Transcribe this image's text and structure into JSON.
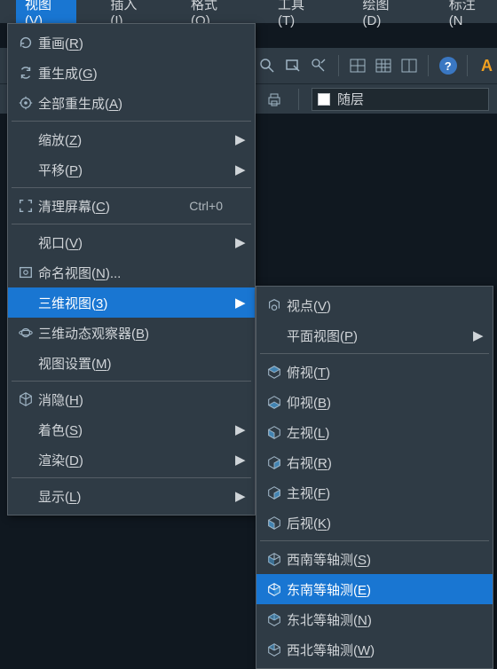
{
  "menubar": {
    "items": [
      {
        "text": "视图(V)",
        "open": true
      },
      {
        "text": "插入(I)",
        "open": false
      },
      {
        "text": "格式(O)",
        "open": false
      },
      {
        "text": "工具(T)",
        "open": false
      },
      {
        "text": "绘图(D)",
        "open": false
      },
      {
        "text": "标注(N",
        "open": false
      }
    ]
  },
  "layer": {
    "current": "随层"
  },
  "primary_menu": [
    {
      "kind": "item",
      "icon": "refresh-icon",
      "label": "重画",
      "accel": "R",
      "submenu": false
    },
    {
      "kind": "item",
      "icon": "regen-icon",
      "label": "重生成",
      "accel": "G",
      "submenu": false
    },
    {
      "kind": "item",
      "icon": "regen-all-icon",
      "label": "全部重生成",
      "accel": "A",
      "submenu": false
    },
    {
      "kind": "sep"
    },
    {
      "kind": "item",
      "icon": "",
      "label": "缩放",
      "accel": "Z",
      "submenu": true
    },
    {
      "kind": "item",
      "icon": "",
      "label": "平移",
      "accel": "P",
      "submenu": true
    },
    {
      "kind": "sep"
    },
    {
      "kind": "item",
      "icon": "fullscreen-icon",
      "label": "清理屏幕",
      "accel": "C",
      "shortcut": "Ctrl+0",
      "submenu": false
    },
    {
      "kind": "sep"
    },
    {
      "kind": "item",
      "icon": "",
      "label": "视口",
      "accel": "V",
      "submenu": true
    },
    {
      "kind": "item",
      "icon": "named-view-icon",
      "label": "命名视图",
      "accel": "N",
      "suffix": "...",
      "submenu": false
    },
    {
      "kind": "item",
      "icon": "",
      "label": "三维视图",
      "accel": "3",
      "submenu": true,
      "highlight": true
    },
    {
      "kind": "item",
      "icon": "orbit-icon",
      "label": "三维动态观察器",
      "accel": "B",
      "submenu": false
    },
    {
      "kind": "item",
      "icon": "",
      "label": "视图设置",
      "accel": "M",
      "submenu": false
    },
    {
      "kind": "sep"
    },
    {
      "kind": "item",
      "icon": "cube-icon",
      "label": "消隐",
      "accel": "H",
      "submenu": false
    },
    {
      "kind": "item",
      "icon": "",
      "label": "着色",
      "accel": "S",
      "submenu": true
    },
    {
      "kind": "item",
      "icon": "",
      "label": "渲染",
      "accel": "D",
      "submenu": true
    },
    {
      "kind": "sep"
    },
    {
      "kind": "item",
      "icon": "",
      "label": "显示",
      "accel": "L",
      "submenu": true
    }
  ],
  "secondary_menu": [
    {
      "kind": "item",
      "icon": "viewpoint-icon",
      "label": "视点",
      "accel": "V",
      "submenu": false
    },
    {
      "kind": "item",
      "icon": "",
      "label": "平面视图",
      "accel": "P",
      "submenu": true
    },
    {
      "kind": "sep"
    },
    {
      "kind": "item",
      "icon": "face-top-icon",
      "label": "俯视",
      "accel": "T",
      "submenu": false
    },
    {
      "kind": "item",
      "icon": "face-bottom-icon",
      "label": "仰视",
      "accel": "B",
      "submenu": false
    },
    {
      "kind": "item",
      "icon": "face-left-icon",
      "label": "左视",
      "accel": "L",
      "submenu": false
    },
    {
      "kind": "item",
      "icon": "face-right-icon",
      "label": "右视",
      "accel": "R",
      "submenu": false
    },
    {
      "kind": "item",
      "icon": "face-front-icon",
      "label": "主视",
      "accel": "F",
      "submenu": false
    },
    {
      "kind": "item",
      "icon": "face-back-icon",
      "label": "后视",
      "accel": "K",
      "submenu": false
    },
    {
      "kind": "sep"
    },
    {
      "kind": "item",
      "icon": "iso-sw-icon",
      "label": "西南等轴测",
      "accel": "S",
      "submenu": false
    },
    {
      "kind": "item",
      "icon": "iso-se-icon",
      "label": "东南等轴测",
      "accel": "E",
      "submenu": false,
      "highlight": true
    },
    {
      "kind": "item",
      "icon": "iso-ne-icon",
      "label": "东北等轴测",
      "accel": "N",
      "submenu": false
    },
    {
      "kind": "item",
      "icon": "iso-nw-icon",
      "label": "西北等轴测",
      "accel": "W",
      "submenu": false
    }
  ]
}
